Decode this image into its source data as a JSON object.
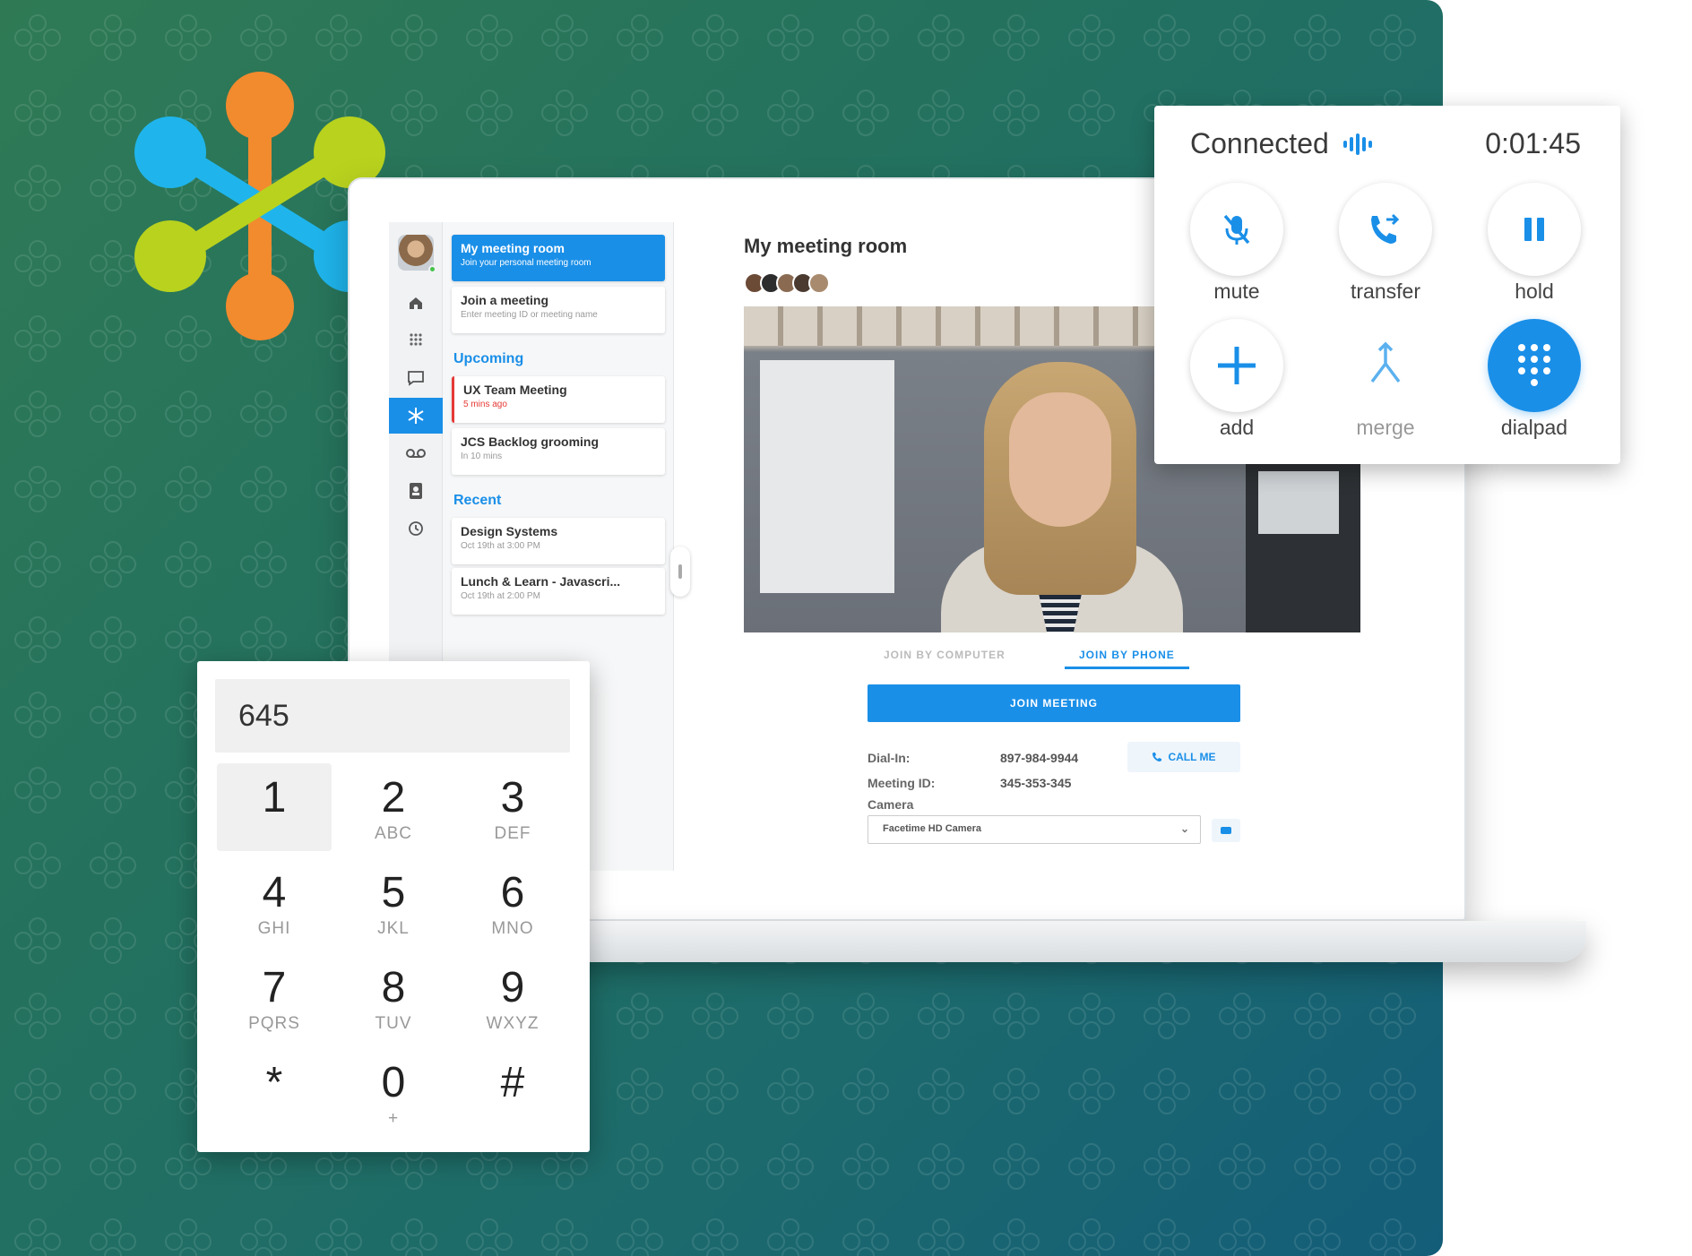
{
  "app": {
    "nav_items": [
      {
        "icon": "home-icon"
      },
      {
        "icon": "dialpad-grid-icon"
      },
      {
        "icon": "chat-icon"
      },
      {
        "icon": "meetings-icon",
        "active": true
      },
      {
        "icon": "voicemail-icon"
      },
      {
        "icon": "contacts-icon"
      },
      {
        "icon": "history-icon"
      }
    ],
    "list": {
      "my_room": {
        "title": "My meeting room",
        "subtitle": "Join your personal meeting room"
      },
      "join": {
        "title": "Join a meeting",
        "subtitle": "Enter meeting ID or meeting name"
      },
      "upcoming_label": "Upcoming",
      "upcoming": [
        {
          "title": "UX Team Meeting",
          "subtitle": "5 mins ago"
        },
        {
          "title": "JCS Backlog grooming",
          "subtitle": "In 10 mins"
        }
      ],
      "recent_label": "Recent",
      "recent": [
        {
          "title": "Design Systems",
          "subtitle": "Oct 19th at 3:00 PM"
        },
        {
          "title": "Lunch & Learn - Javascri...",
          "subtitle": "Oct 19th at 2:00 PM"
        }
      ]
    },
    "main": {
      "title": "My meeting room",
      "tabs": {
        "computer": "JOIN BY COMPUTER",
        "phone": "JOIN BY PHONE"
      },
      "join_button": "JOIN MEETING",
      "dial_in_label": "Dial-In:",
      "dial_in_value": "897-984-9944",
      "meeting_id_label": "Meeting ID:",
      "meeting_id_value": "345-353-345",
      "call_me": "CALL ME",
      "camera_label": "Camera",
      "camera_value": "Facetime HD Camera"
    }
  },
  "call": {
    "status": "Connected",
    "timer": "0:01:45",
    "buttons": [
      {
        "label": "mute",
        "icon": "mute-icon"
      },
      {
        "label": "transfer",
        "icon": "transfer-icon"
      },
      {
        "label": "hold",
        "icon": "pause-icon"
      },
      {
        "label": "add",
        "icon": "plus-icon"
      },
      {
        "label": "merge",
        "icon": "merge-icon",
        "disabled": true
      },
      {
        "label": "dialpad",
        "icon": "dialpad-icon",
        "active": true
      }
    ],
    "accent": "#1a8fe8"
  },
  "dialpad": {
    "display": "645",
    "keys": [
      {
        "digit": "1",
        "letters": ""
      },
      {
        "digit": "2",
        "letters": "ABC"
      },
      {
        "digit": "3",
        "letters": "DEF"
      },
      {
        "digit": "4",
        "letters": "GHI"
      },
      {
        "digit": "5",
        "letters": "JKL"
      },
      {
        "digit": "6",
        "letters": "MNO"
      },
      {
        "digit": "7",
        "letters": "PQRS"
      },
      {
        "digit": "8",
        "letters": "TUV"
      },
      {
        "digit": "9",
        "letters": "WXYZ"
      },
      {
        "digit": "*",
        "letters": ""
      },
      {
        "digit": "0",
        "letters": "+"
      },
      {
        "digit": "#",
        "letters": ""
      }
    ]
  }
}
